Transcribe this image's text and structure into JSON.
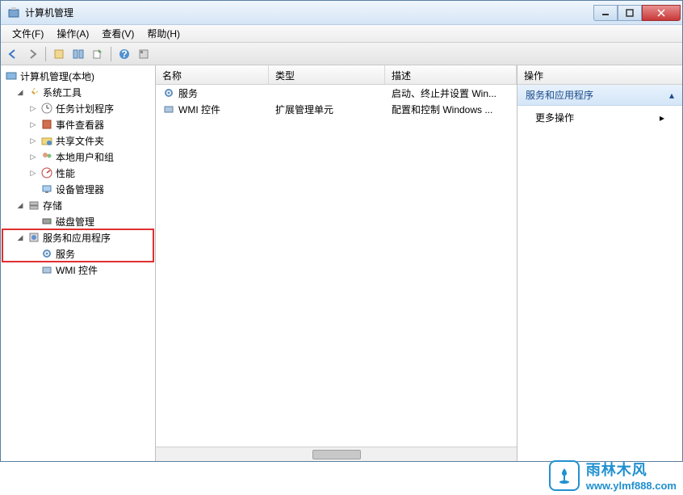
{
  "window": {
    "title": "计算机管理"
  },
  "menus": {
    "file": "文件(F)",
    "action": "操作(A)",
    "view": "查看(V)",
    "help": "帮助(H)"
  },
  "tree": {
    "root": "计算机管理(本地)",
    "systools": "系统工具",
    "taskscheduler": "任务计划程序",
    "eventviewer": "事件查看器",
    "shares": "共享文件夹",
    "localuser": "本地用户和组",
    "perf": "性能",
    "devmgr": "设备管理器",
    "storage": "存储",
    "diskmgmt": "磁盘管理",
    "svcapp": "服务和应用程序",
    "services": "服务",
    "wmi": "WMI 控件"
  },
  "list": {
    "cols": {
      "name": "名称",
      "type": "类型",
      "desc": "描述"
    },
    "rows": [
      {
        "name": "服务",
        "type": "",
        "desc": "启动、终止并设置 Win..."
      },
      {
        "name": "WMI 控件",
        "type": "扩展管理单元",
        "desc": "配置和控制 Windows ..."
      }
    ]
  },
  "actions": {
    "header": "操作",
    "section": "服务和应用程序",
    "more": "更多操作"
  },
  "watermark": {
    "cn": "雨林木风",
    "url": "www.ylmf888.com"
  }
}
